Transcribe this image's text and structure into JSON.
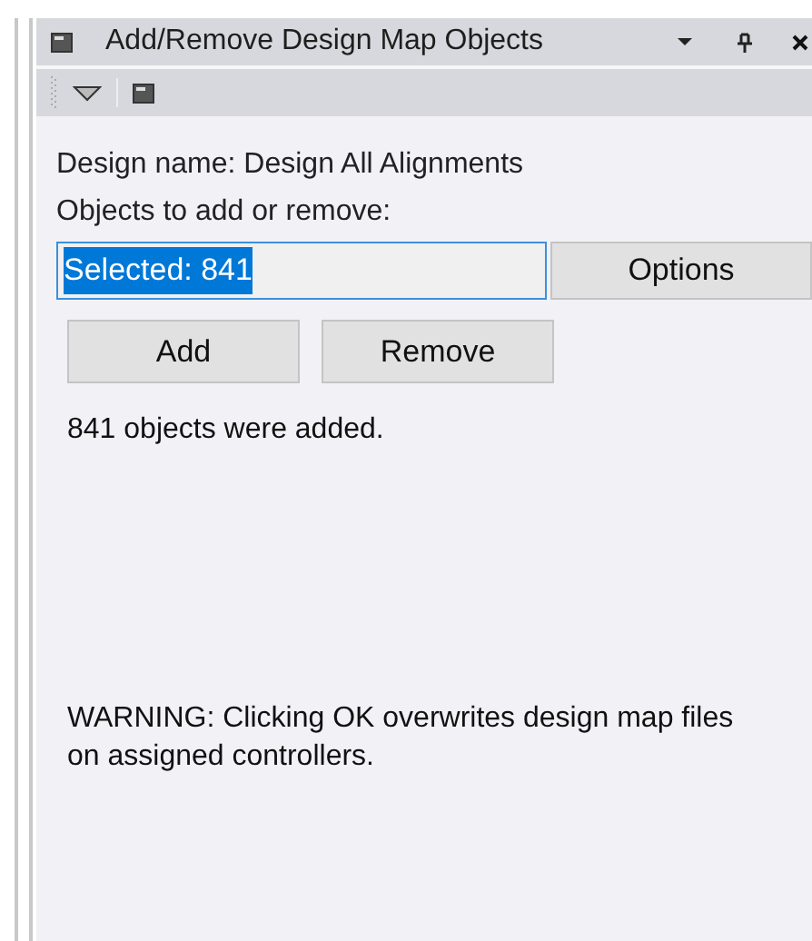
{
  "panel": {
    "title": "Add/Remove Design Map Objects"
  },
  "design_name": "Design name: Design All Alignments",
  "objects_label": "Objects to add or remove:",
  "objects_field": {
    "value": "Selected: 841",
    "highlighted": true
  },
  "buttons": [
    {
      "label": "Options"
    },
    {
      "label": "Add"
    },
    {
      "label": "Remove"
    }
  ],
  "status": "841 objects were added.",
  "warning": "WARNING: Clicking OK overwrites design map files on assigned controllers."
}
